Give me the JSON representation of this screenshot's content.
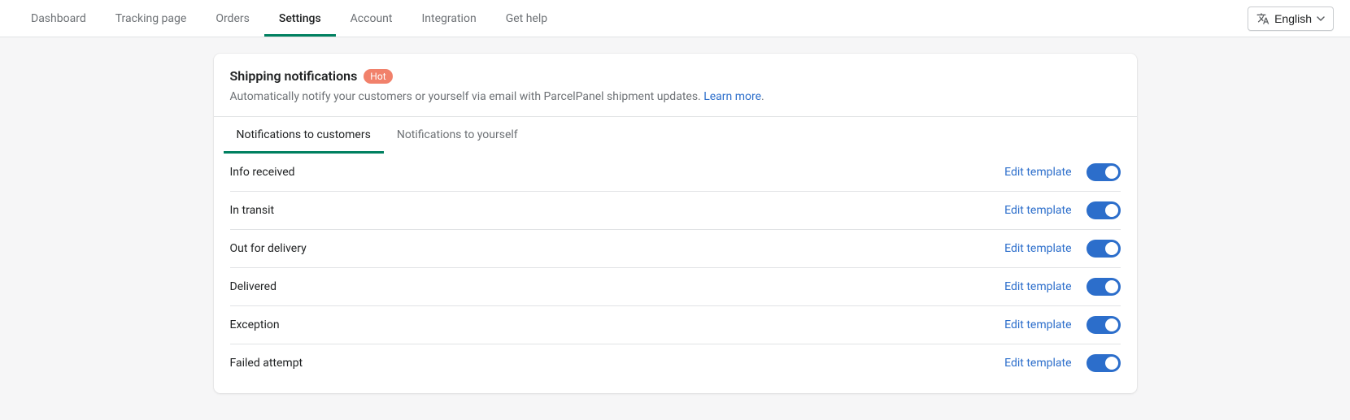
{
  "nav": {
    "items": [
      {
        "label": "Dashboard",
        "active": false
      },
      {
        "label": "Tracking page",
        "active": false
      },
      {
        "label": "Orders",
        "active": false
      },
      {
        "label": "Settings",
        "active": true
      },
      {
        "label": "Account",
        "active": false
      },
      {
        "label": "Integration",
        "active": false
      },
      {
        "label": "Get help",
        "active": false
      }
    ],
    "language": "English"
  },
  "card": {
    "title": "Shipping notifications",
    "badge": "Hot",
    "subtitle": "Automatically notify your customers or yourself via email with ParcelPanel shipment updates. ",
    "learn_more": "Learn more",
    "tabs": [
      {
        "label": "Notifications to customers",
        "active": true
      },
      {
        "label": "Notifications to yourself",
        "active": false
      }
    ],
    "edit_label": "Edit template",
    "rows": [
      {
        "label": "Info received",
        "enabled": true
      },
      {
        "label": "In transit",
        "enabled": true
      },
      {
        "label": "Out for delivery",
        "enabled": true
      },
      {
        "label": "Delivered",
        "enabled": true
      },
      {
        "label": "Exception",
        "enabled": true
      },
      {
        "label": "Failed attempt",
        "enabled": true
      }
    ]
  }
}
